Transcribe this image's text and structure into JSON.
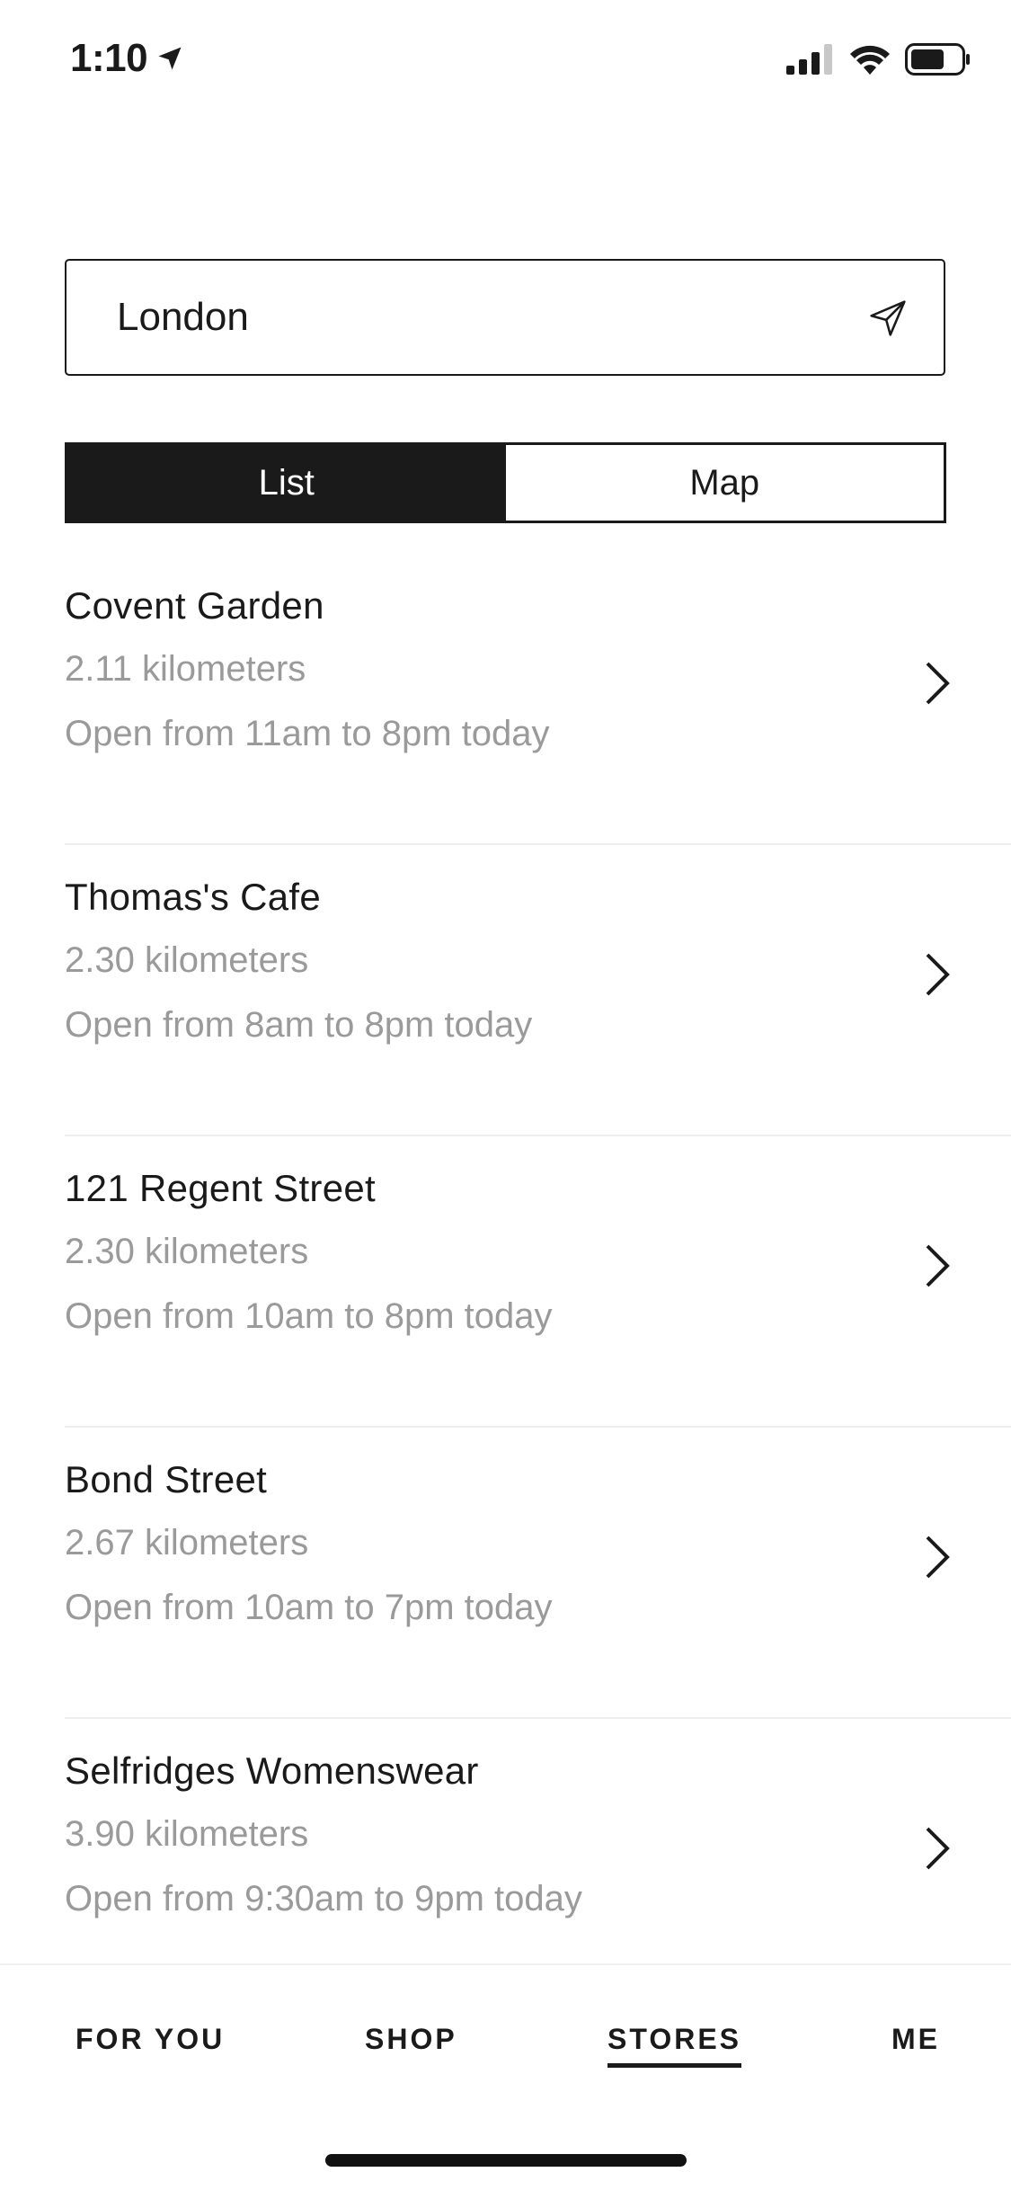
{
  "status_bar": {
    "time": "1:10",
    "icons": [
      "location-arrow-icon",
      "cellular-signal-icon",
      "wifi-icon",
      "battery-icon"
    ]
  },
  "search": {
    "value": "London",
    "icon": "locate-me-icon"
  },
  "view_toggle": {
    "options": [
      "List",
      "Map"
    ],
    "selected": "List"
  },
  "stores": [
    {
      "name": "Covent Garden",
      "distance": "2.11 kilometers",
      "hours": "Open from 11am to 8pm today"
    },
    {
      "name": "Thomas's Cafe",
      "distance": "2.30 kilometers",
      "hours": "Open from 8am to 8pm today"
    },
    {
      "name": "121 Regent Street",
      "distance": "2.30 kilometers",
      "hours": "Open from 10am to 8pm today"
    },
    {
      "name": "Bond Street",
      "distance": "2.67 kilometers",
      "hours": "Open from 10am to 7pm today"
    },
    {
      "name": "Selfridges Womenswear",
      "distance": "3.90 kilometers",
      "hours": "Open from 9:30am to 9pm today"
    }
  ],
  "tab_bar": {
    "tabs": [
      "FOR YOU",
      "SHOP",
      "STORES",
      "ME"
    ],
    "active": "STORES"
  },
  "colors": {
    "primary": "#1a1a1a",
    "secondary_text": "#9a9a9a",
    "divider": "#eeeeee",
    "background": "#ffffff"
  }
}
